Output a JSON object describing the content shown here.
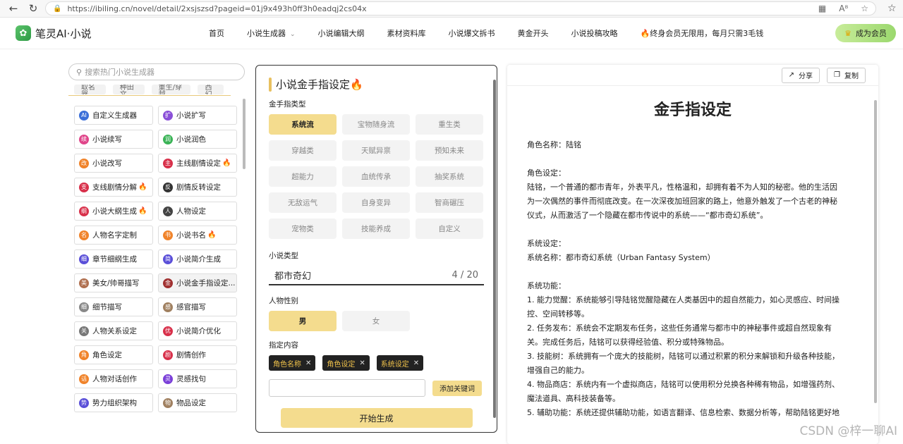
{
  "browser": {
    "url": "https://ibiling.cn/novel/detail/2xsjszsd?pageid=01j9x493h0ff3h0eadqj2cs04x"
  },
  "header": {
    "logo_text": "笔灵AI·小说",
    "nav": [
      "首页",
      "小说生成器",
      "小说编辑大纲",
      "素材资料库",
      "小说爆文拆书",
      "黄金开头",
      "小说投稿攻略"
    ],
    "promo": "终身会员无限用，每月只需3毛钱",
    "member_label": "成为会员"
  },
  "sidebar": {
    "search_placeholder": "搜索热门小说生成器",
    "tags": [
      "取名器",
      "种田文",
      "重生/穿越",
      "西幻"
    ],
    "tools": [
      {
        "label": "自定义生成器",
        "icon_text": "AI",
        "color": "#3b6fd8",
        "hot": false
      },
      {
        "label": "小说扩写",
        "icon_text": "扩",
        "color": "#8a4fd8",
        "hot": false
      },
      {
        "label": "小说续写",
        "icon_text": "续",
        "color": "#e0458a",
        "hot": false
      },
      {
        "label": "小说润色",
        "icon_text": "润",
        "color": "#3ab356",
        "hot": false
      },
      {
        "label": "小说改写",
        "icon_text": "改",
        "color": "#f0832a",
        "hot": false
      },
      {
        "label": "主线剧情设定",
        "icon_text": "主",
        "color": "#d8304a",
        "hot": true
      },
      {
        "label": "支线剧情分解",
        "icon_text": "支",
        "color": "#d8304a",
        "hot": true
      },
      {
        "label": "剧情反转设定",
        "icon_text": "反",
        "color": "#333333",
        "hot": false
      },
      {
        "label": "小说大纲生成",
        "icon_text": "纲",
        "color": "#d8304a",
        "hot": true
      },
      {
        "label": "人物设定",
        "icon_text": "人",
        "color": "#444444",
        "hot": false
      },
      {
        "label": "人物名字定制",
        "icon_text": "名",
        "color": "#f0832a",
        "hot": false
      },
      {
        "label": "小说书名",
        "icon_text": "书",
        "color": "#f0832a",
        "hot": true
      },
      {
        "label": "章节细纲生成",
        "icon_text": "细",
        "color": "#5a4fd8",
        "hot": false
      },
      {
        "label": "小说简介生成",
        "icon_text": "简",
        "color": "#5a4fd8",
        "hot": false
      },
      {
        "label": "美女/帅哥描写",
        "icon_text": "美",
        "color": "#b07050",
        "hot": false
      },
      {
        "label": "小说金手指设定...",
        "icon_text": "金",
        "color": "#a03030",
        "hot": false,
        "active": true
      },
      {
        "label": "细节描写",
        "icon_text": "细",
        "color": "#888888",
        "hot": false
      },
      {
        "label": "感官描写",
        "icon_text": "感",
        "color": "#a08060",
        "hot": false
      },
      {
        "label": "人物关系设定",
        "icon_text": "关",
        "color": "#777777",
        "hot": false
      },
      {
        "label": "小说简介优化",
        "icon_text": "优",
        "color": "#d8304a",
        "hot": false
      },
      {
        "label": "角色设定",
        "icon_text": "角",
        "color": "#f0832a",
        "hot": false
      },
      {
        "label": "剧情创作",
        "icon_text": "剧",
        "color": "#d8304a",
        "hot": false
      },
      {
        "label": "人物对话创作",
        "icon_text": "话",
        "color": "#f0832a",
        "hot": false
      },
      {
        "label": "灵感找句",
        "icon_text": "灵",
        "color": "#7a3fd8",
        "hot": false
      },
      {
        "label": "势力组织架构",
        "icon_text": "势",
        "color": "#5a4fd8",
        "hot": false
      },
      {
        "label": "物品设定",
        "icon_text": "物",
        "color": "#a08060",
        "hot": false
      }
    ]
  },
  "form": {
    "title": "小说金手指设定",
    "type_label": "金手指类型",
    "types": [
      {
        "label": "系统流",
        "selected": true
      },
      {
        "label": "宝物随身流",
        "selected": false
      },
      {
        "label": "重生类",
        "selected": false
      },
      {
        "label": "穿越类",
        "selected": false
      },
      {
        "label": "天赋异禀",
        "selected": false
      },
      {
        "label": "预知未来",
        "selected": false
      },
      {
        "label": "超能力",
        "selected": false
      },
      {
        "label": "血统传承",
        "selected": false
      },
      {
        "label": "抽奖系统",
        "selected": false
      },
      {
        "label": "无敌运气",
        "selected": false
      },
      {
        "label": "自身变异",
        "selected": false
      },
      {
        "label": "智商碾压",
        "selected": false
      },
      {
        "label": "宠物类",
        "selected": false
      },
      {
        "label": "技能养成",
        "selected": false
      },
      {
        "label": "自定义",
        "selected": false
      }
    ],
    "genre_label": "小说类型",
    "genre_value": "都市奇幻",
    "genre_count": "4 / 20",
    "gender_label": "人物性别",
    "gender_male": "男",
    "gender_female": "女",
    "content_label": "指定内容",
    "chips": [
      "角色名称",
      "角色设定",
      "系统设定"
    ],
    "add_keyword": "添加关键词",
    "generate": "开始生成"
  },
  "doc": {
    "share": "分享",
    "copy": "复制",
    "title": "金手指设定",
    "lines": [
      "角色名称：陆铭",
      "",
      "角色设定：",
      "陆铭，一个普通的都市青年，外表平凡，性格温和，却拥有着不为人知的秘密。他的生活因",
      "为一次偶然的事件而彻底改变。在一次深夜加班回家的路上，他意外触发了一个古老的神秘",
      "仪式，从而激活了一个隐藏在都市传说中的系统——“都市奇幻系统”。",
      "",
      "系统设定：",
      "系统名称：都市奇幻系统（Urban Fantasy System）",
      "",
      "系统功能：",
      "1. 能力觉醒：系统能够引导陆铭觉醒隐藏在人类基因中的超自然能力，如心灵感应、时间操",
      "控、空间转移等。",
      "2. 任务发布：系统会不定期发布任务，这些任务通常与都市中的神秘事件或超自然现象有",
      "关。完成任务后，陆铭可以获得经验值、积分或特殊物品。",
      "3. 技能树：系统拥有一个庞大的技能树，陆铭可以通过积累的积分来解锁和升级各种技能，",
      "增强自己的能力。",
      "4. 物品商店：系统内有一个虚拟商店，陆铭可以使用积分兑换各种稀有物品，如增强药剂、",
      "魔法道具、高科技装备等。",
      "5. 辅助功能：系统还提供辅助功能，如语言翻译、信息检索、数据分析等，帮助陆铭更好地"
    ]
  },
  "watermark": "CSDN @梓一聊AI"
}
